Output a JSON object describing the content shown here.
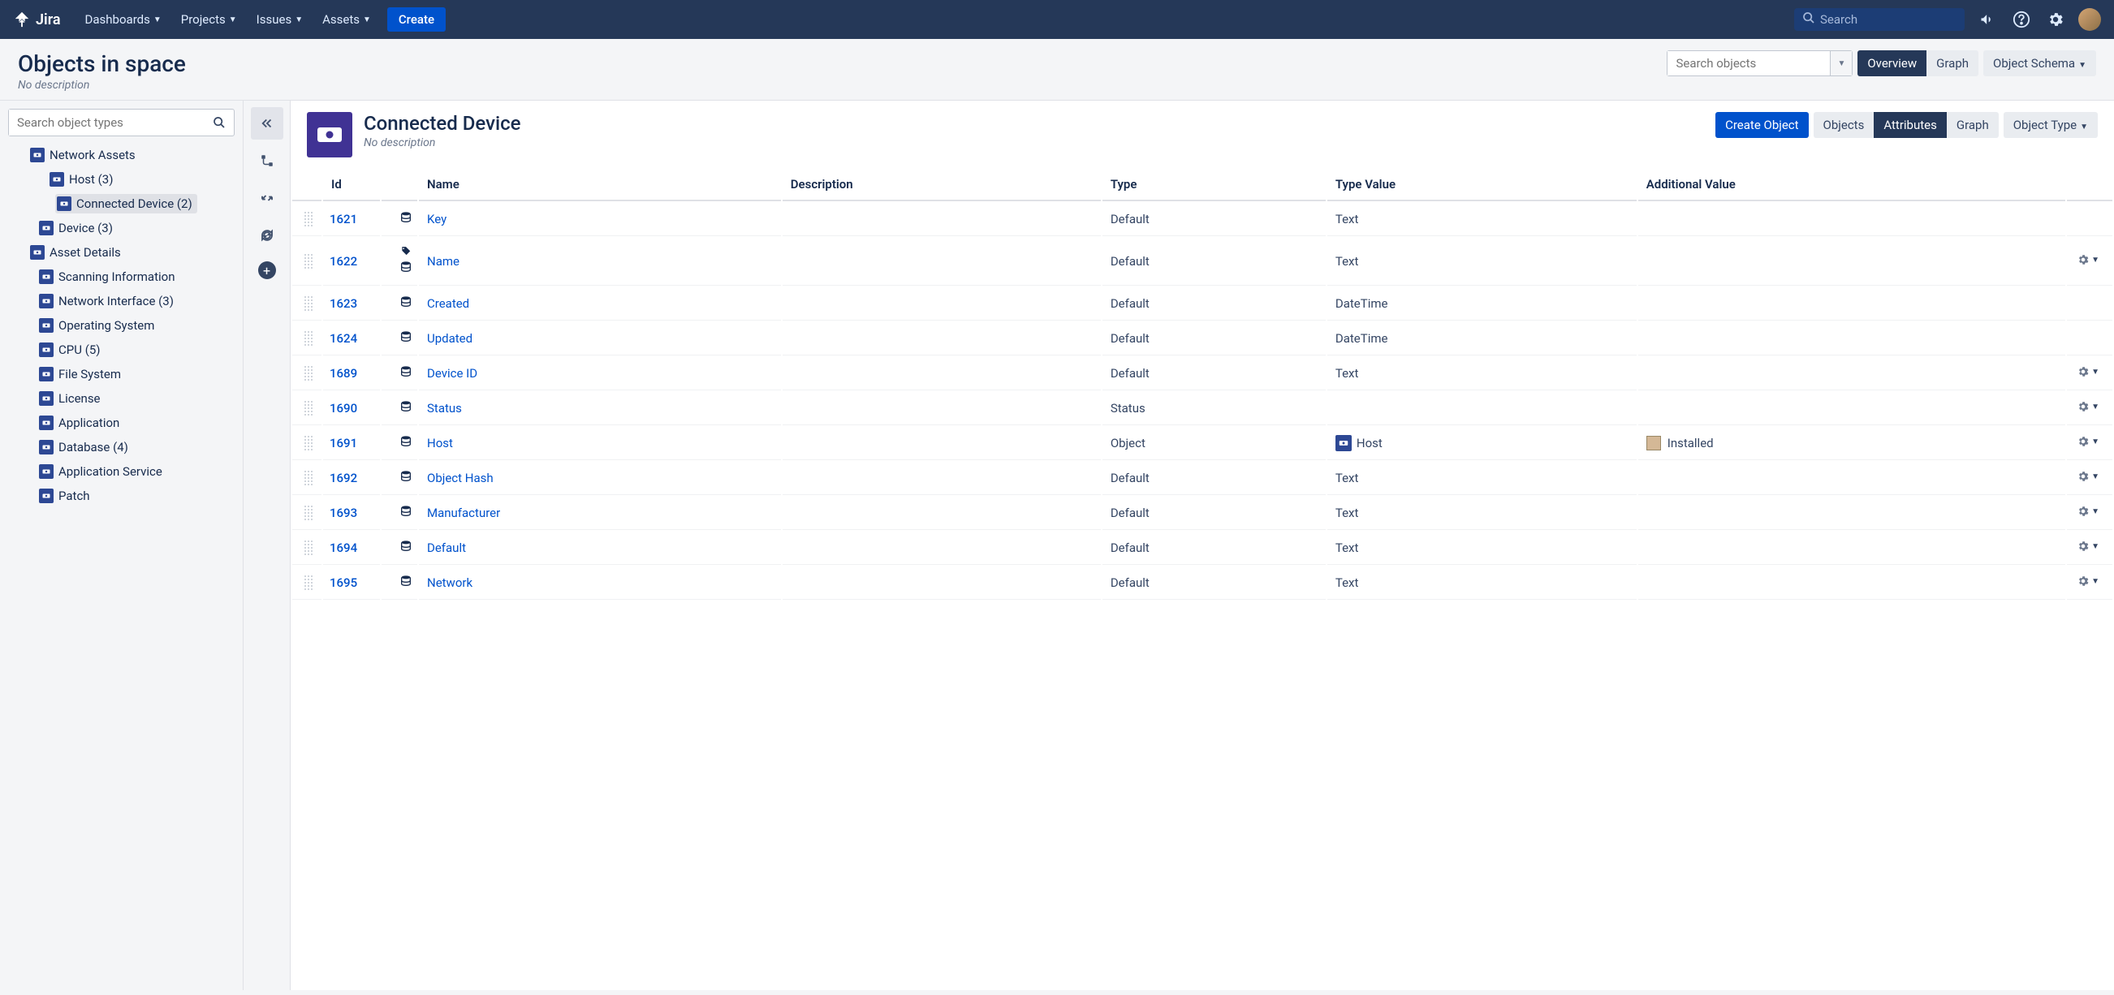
{
  "topnav": {
    "logo": "Jira",
    "items": [
      "Dashboards",
      "Projects",
      "Issues",
      "Assets"
    ],
    "create": "Create",
    "search_placeholder": "Search"
  },
  "page": {
    "title": "Objects in space",
    "subtitle": "No description",
    "search_objects_placeholder": "Search objects",
    "overview": "Overview",
    "graph": "Graph",
    "object_schema": "Object Schema"
  },
  "sidebar": {
    "search_placeholder": "Search object types",
    "tree": [
      {
        "label": "Network Assets",
        "level": 0
      },
      {
        "label": "Host",
        "count": "(3)",
        "level": 1
      },
      {
        "label": "Connected Device",
        "count": "(2)",
        "level": 2,
        "selected": true
      },
      {
        "label": "Device",
        "count": "(3)",
        "level": 1
      },
      {
        "label": "Asset Details",
        "level": 0
      },
      {
        "label": "Scanning Information",
        "level": 1
      },
      {
        "label": "Network Interface",
        "count": "(3)",
        "level": 1
      },
      {
        "label": "Operating System",
        "level": 1
      },
      {
        "label": "CPU",
        "count": "(5)",
        "level": 1
      },
      {
        "label": "File System",
        "level": 1
      },
      {
        "label": "License",
        "level": 1
      },
      {
        "label": "Application",
        "level": 1
      },
      {
        "label": "Database",
        "count": "(4)",
        "level": 1
      },
      {
        "label": "Application Service",
        "level": 1
      },
      {
        "label": "Patch",
        "level": 1
      }
    ]
  },
  "content": {
    "title": "Connected Device",
    "subtitle": "No description",
    "create_object": "Create Object",
    "tabs": {
      "objects": "Objects",
      "attributes": "Attributes",
      "graph": "Graph"
    },
    "object_type": "Object Type"
  },
  "table": {
    "headers": {
      "id": "Id",
      "name": "Name",
      "description": "Description",
      "type": "Type",
      "type_value": "Type Value",
      "additional_value": "Additional Value"
    },
    "rows": [
      {
        "id": "1621",
        "name": "Key",
        "type": "Default",
        "type_value": "Text",
        "has_tag": false,
        "gear": false
      },
      {
        "id": "1622",
        "name": "Name",
        "type": "Default",
        "type_value": "Text",
        "has_tag": true,
        "gear": true
      },
      {
        "id": "1623",
        "name": "Created",
        "type": "Default",
        "type_value": "DateTime",
        "has_tag": false,
        "gear": false
      },
      {
        "id": "1624",
        "name": "Updated",
        "type": "Default",
        "type_value": "DateTime",
        "has_tag": false,
        "gear": false
      },
      {
        "id": "1689",
        "name": "Device ID",
        "type": "Default",
        "type_value": "Text",
        "has_tag": false,
        "gear": true
      },
      {
        "id": "1690",
        "name": "Status",
        "type": "Status",
        "type_value": "",
        "has_tag": false,
        "gear": true
      },
      {
        "id": "1691",
        "name": "Host",
        "type": "Object",
        "type_value": "Host",
        "tv_object": true,
        "additional": "Installed",
        "has_tag": false,
        "gear": true
      },
      {
        "id": "1692",
        "name": "Object Hash",
        "type": "Default",
        "type_value": "Text",
        "has_tag": false,
        "gear": true
      },
      {
        "id": "1693",
        "name": "Manufacturer",
        "type": "Default",
        "type_value": "Text",
        "has_tag": false,
        "gear": true
      },
      {
        "id": "1694",
        "name": "Default",
        "type": "Default",
        "type_value": "Text",
        "has_tag": false,
        "gear": true
      },
      {
        "id": "1695",
        "name": "Network",
        "type": "Default",
        "type_value": "Text",
        "has_tag": false,
        "gear": true
      }
    ]
  }
}
